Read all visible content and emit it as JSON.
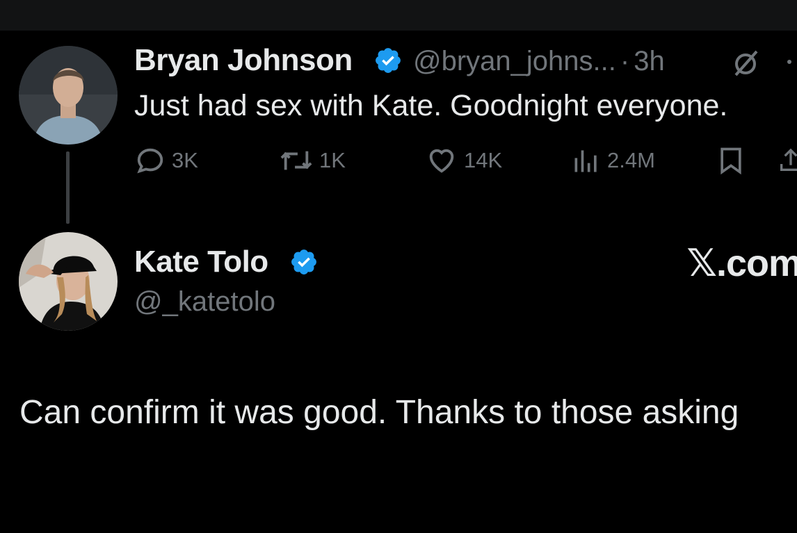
{
  "tweet": {
    "author_name": "Bryan Johnson",
    "author_handle": "@bryan_johns...",
    "separator": "·",
    "time": "3h",
    "text": "Just had sex with Kate. Goodnight everyone.",
    "stats": {
      "replies": "3K",
      "reposts": "1K",
      "likes": "14K",
      "views": "2.4M"
    }
  },
  "reply": {
    "author_name": "Kate Tolo",
    "author_handle": "@_katetolo",
    "text": "Can confirm it was good. Thanks to those asking",
    "watermark": "𝕏.com"
  },
  "colors": {
    "background": "#000000",
    "text": "#e7e9ea",
    "muted": "#71767b",
    "verified": "#1d9bf0"
  }
}
